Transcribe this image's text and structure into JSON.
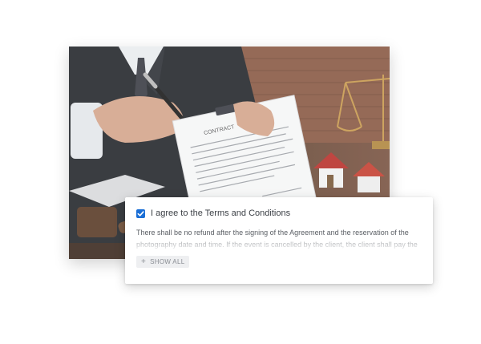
{
  "terms": {
    "agree_label": "I agree to the Terms and Conditions",
    "checked": true,
    "body": "There shall be no refund after the signing of the Agreement and the reservation of the photography date and time. If the event is cancelled by the client, the client shall pay the",
    "show_all_label": "SHOW ALL",
    "show_all_icon": "plus-icon"
  },
  "photo": {
    "document_heading": "CONTRACT",
    "subject": "contract-signing-photo"
  },
  "colors": {
    "checkbox": "#1b6fd6"
  }
}
